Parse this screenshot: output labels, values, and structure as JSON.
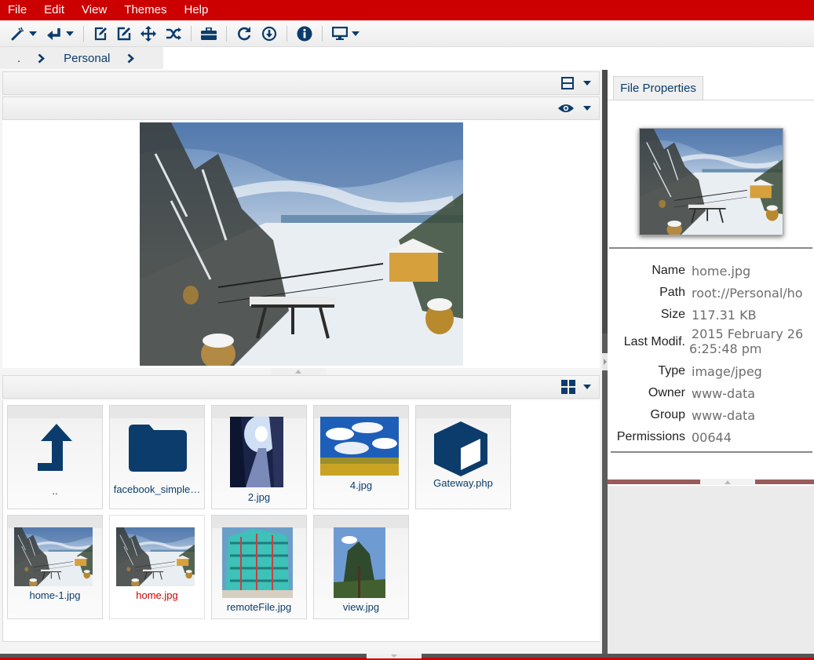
{
  "colors": {
    "menubar": "#cc0000",
    "icon_blue": "#0b3c6b",
    "selected_label": "#cc0000"
  },
  "menu": [
    "File",
    "Edit",
    "View",
    "Themes",
    "Help"
  ],
  "toolbar": {
    "icons": [
      "magic-wand-icon",
      "return-icon",
      "edit-icon",
      "rename-icon",
      "move-icon",
      "shuffle-icon",
      "briefcase-icon",
      "refresh-icon",
      "download-icon",
      "info-icon",
      "monitor-icon"
    ]
  },
  "breadcrumb": {
    "root": ".",
    "items": [
      "Personal"
    ]
  },
  "files": [
    {
      "name": "..",
      "kind": "up-folder"
    },
    {
      "name": "facebook_simple…",
      "kind": "folder"
    },
    {
      "name": "2.jpg",
      "kind": "image"
    },
    {
      "name": "4.jpg",
      "kind": "image"
    },
    {
      "name": "Gateway.php",
      "kind": "file"
    },
    {
      "name": "home-1.jpg",
      "kind": "image"
    },
    {
      "name": "home.jpg",
      "kind": "image",
      "selected": true
    },
    {
      "name": "remoteFile.jpg",
      "kind": "image"
    },
    {
      "name": "view.jpg",
      "kind": "image"
    }
  ],
  "properties": {
    "tab_label": "File Properties",
    "rows": [
      {
        "label": "Name",
        "value": "home.jpg"
      },
      {
        "label": "Path",
        "value": "root://Personal/ho"
      },
      {
        "label": "Size",
        "value": "117.31 KB"
      },
      {
        "label": "Last Modif.",
        "value": "2015 February 26",
        "value2": "6:25:48 pm"
      },
      {
        "label": "Type",
        "value": "image/jpeg"
      },
      {
        "label": "Owner",
        "value": "www-data"
      },
      {
        "label": "Group",
        "value": "www-data"
      },
      {
        "label": "Permissions",
        "value": "00644"
      }
    ]
  }
}
